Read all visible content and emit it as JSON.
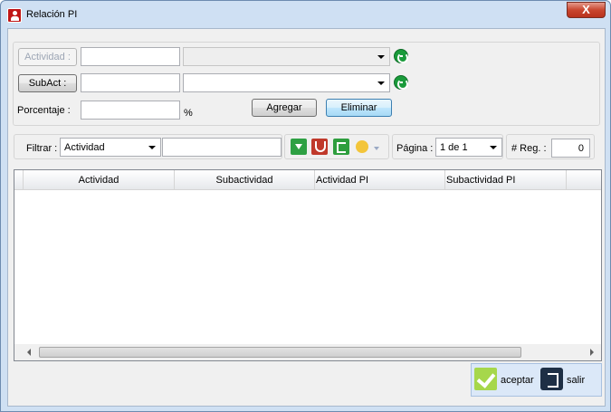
{
  "window": {
    "title": "Relación PI",
    "close_symbol": "X"
  },
  "form": {
    "actividad_button": "Actividad :",
    "subact_button": "SubAct :",
    "porcentaje_label": "Porcentaje :",
    "percent_symbol": "%",
    "agregar_button": "Agregar",
    "eliminar_button": "Eliminar"
  },
  "filter": {
    "label": "Filtrar :",
    "field_selected": "Actividad",
    "search_value": "",
    "pagina_label": "Página :",
    "pagina_selected": "1 de 1",
    "reg_label": "# Reg. :",
    "reg_value": "0"
  },
  "grid": {
    "columns": [
      "Actividad",
      "Subactividad",
      "Actividad PI",
      "Subactividad PI"
    ],
    "rows": []
  },
  "footer": {
    "accept_label": "aceptar",
    "exit_label": "salir"
  },
  "icons": [
    "app-icon",
    "refresh-icon",
    "download-filter-icon",
    "magnet-icon",
    "export-icon",
    "bulb-icon",
    "check-icon",
    "exit-door-icon"
  ]
}
